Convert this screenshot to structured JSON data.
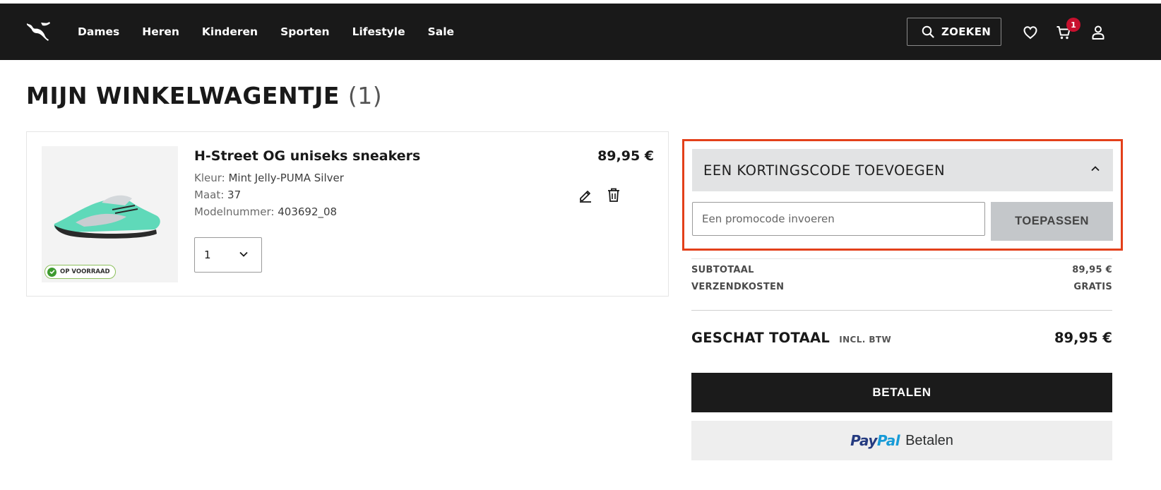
{
  "header": {
    "nav": [
      "Dames",
      "Heren",
      "Kinderen",
      "Sporten",
      "Lifestyle",
      "Sale"
    ],
    "search_label": "ZOEKEN",
    "cart_count": "1",
    "icons": [
      "puma-logo-icon",
      "search-icon",
      "heart-icon",
      "cart-icon",
      "user-icon"
    ]
  },
  "page": {
    "title": "MIJN WINKELWAGENTJE",
    "count": "(1)"
  },
  "item": {
    "name": "H-Street OG uniseks sneakers",
    "price": "89,95 €",
    "color_label": "Kleur:",
    "color_value": "Mint Jelly-PUMA Silver",
    "size_label": "Maat:",
    "size_value": "37",
    "model_label": "Modelnummer:",
    "model_value": "403692_08",
    "stock": "OP VOORRAAD",
    "quantity": "1"
  },
  "promo": {
    "header": "EEN KORTINGSCODE TOEVOEGEN",
    "placeholder": "Een promocode invoeren",
    "apply_label": "TOEPASSEN"
  },
  "summary": {
    "subtotal_label": "SUBTOTAAL",
    "subtotal_value": "89,95 €",
    "shipping_label": "VERZENDKOSTEN",
    "shipping_value": "GRATIS",
    "total_label": "GESCHAT TOTAAL",
    "total_note": "INCL. BTW",
    "total_value": "89,95 €",
    "pay_label": "BETALEN",
    "paypal_brand_a": "Pay",
    "paypal_brand_b": "Pal",
    "paypal_label": "Betalen"
  },
  "colors": {
    "header_bg": "#191919",
    "highlight_border": "#e3401a",
    "badge_red": "#c8102e",
    "stock_green": "#3d9a2f"
  }
}
